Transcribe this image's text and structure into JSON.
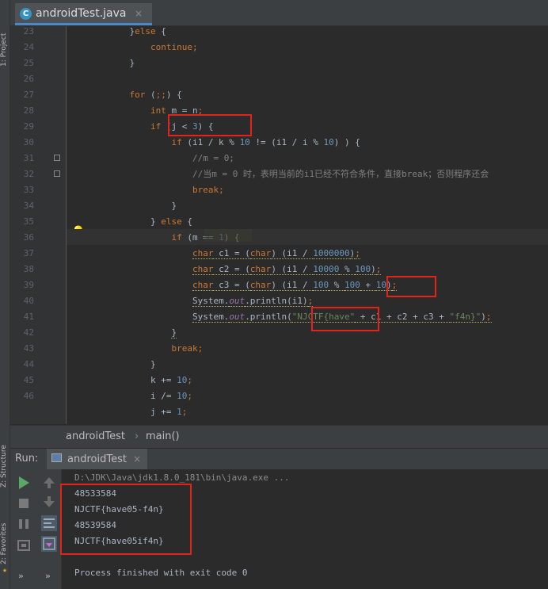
{
  "sidebar": {
    "project_label": "1: Project",
    "structure_label": "Z: Structure",
    "favorites_label": "2: Favorites"
  },
  "editor_tab": {
    "title": "androidTest.java",
    "close": "×"
  },
  "editor": {
    "line_numbers": [
      "23",
      "24",
      "25",
      "26",
      "27",
      "28",
      "29",
      "30",
      "31",
      "32",
      "33",
      "34",
      "35",
      "36",
      "37",
      "38",
      "39",
      "40",
      "41",
      "42",
      "43",
      "44",
      "45",
      "46"
    ],
    "lines": [
      {
        "indent": "            ",
        "parts": [
          {
            "t": "}",
            "c": ""
          },
          {
            "t": "else",
            "c": "kw"
          },
          {
            "t": " {",
            "c": ""
          }
        ]
      },
      {
        "indent": "                ",
        "parts": [
          {
            "t": "continue",
            "c": "kw"
          },
          {
            "t": ";",
            "c": "kw"
          }
        ]
      },
      {
        "indent": "            ",
        "parts": [
          {
            "t": "}",
            "c": ""
          }
        ]
      },
      {
        "indent": "",
        "parts": []
      },
      {
        "indent": "            ",
        "parts": [
          {
            "t": "for",
            "c": "kw"
          },
          {
            "t": " (",
            "c": ""
          },
          {
            "t": ";;",
            "c": "kw"
          },
          {
            "t": ") {",
            "c": ""
          }
        ]
      },
      {
        "indent": "                ",
        "parts": [
          {
            "t": "int",
            "c": "kw"
          },
          {
            "t": " m = n",
            "c": ""
          },
          {
            "t": ";",
            "c": "kw"
          }
        ]
      },
      {
        "indent": "                ",
        "parts": [
          {
            "t": "if",
            "c": "kw"
          },
          {
            "t": " (j < ",
            "c": ""
          },
          {
            "t": "3",
            "c": "num"
          },
          {
            "t": ") {",
            "c": ""
          }
        ]
      },
      {
        "indent": "                    ",
        "parts": [
          {
            "t": "if",
            "c": "kw"
          },
          {
            "t": " (i1 / k % ",
            "c": ""
          },
          {
            "t": "10",
            "c": "num"
          },
          {
            "t": " != (i1 / i % ",
            "c": ""
          },
          {
            "t": "10",
            "c": "num"
          },
          {
            "t": ") ) {",
            "c": ""
          }
        ]
      },
      {
        "indent": "                        ",
        "parts": [
          {
            "t": "//m = 0;",
            "c": "cm"
          }
        ]
      },
      {
        "indent": "                        ",
        "parts": [
          {
            "t": "//当m = 0 时，表明当前的i1已经不符合条件，直接break；否则程序还会",
            "c": "cm"
          }
        ]
      },
      {
        "indent": "                        ",
        "parts": [
          {
            "t": "break",
            "c": "kw"
          },
          {
            "t": ";",
            "c": "kw"
          }
        ]
      },
      {
        "indent": "                    ",
        "parts": [
          {
            "t": "}",
            "c": ""
          }
        ]
      },
      {
        "indent": "                ",
        "parts": [
          {
            "t": "} ",
            "c": ""
          },
          {
            "t": "else",
            "c": "kw"
          },
          {
            "t": " {",
            "c": ""
          }
        ]
      },
      {
        "indent": "                    ",
        "parts": [
          {
            "t": "if",
            "c": "kw"
          },
          {
            "t": " (m == ",
            "c": ""
          },
          {
            "t": "1",
            "c": "num"
          },
          {
            "t": ") {",
            "c": ""
          }
        ]
      },
      {
        "indent": "                        ",
        "parts": [
          {
            "t": "char",
            "c": "kw"
          },
          {
            "t": " c1 = (",
            "c": ""
          },
          {
            "t": "char",
            "c": "kw"
          },
          {
            "t": ") (i1 / ",
            "c": ""
          },
          {
            "t": "1000000",
            "c": "num"
          },
          {
            "t": ")",
            "c": ""
          },
          {
            "t": ";",
            "c": "kw"
          }
        ]
      },
      {
        "indent": "                        ",
        "parts": [
          {
            "t": "char",
            "c": "kw"
          },
          {
            "t": " c2 = (",
            "c": ""
          },
          {
            "t": "char",
            "c": "kw"
          },
          {
            "t": ") (i1 / ",
            "c": ""
          },
          {
            "t": "10000",
            "c": "num"
          },
          {
            "t": " % ",
            "c": ""
          },
          {
            "t": "100",
            "c": "num"
          },
          {
            "t": ")",
            "c": ""
          },
          {
            "t": ";",
            "c": "kw"
          }
        ]
      },
      {
        "indent": "                        ",
        "parts": [
          {
            "t": "char",
            "c": "kw"
          },
          {
            "t": " c3 = (",
            "c": ""
          },
          {
            "t": "char",
            "c": "kw"
          },
          {
            "t": ") (i1 / ",
            "c": ""
          },
          {
            "t": "100",
            "c": "num"
          },
          {
            "t": " % ",
            "c": ""
          },
          {
            "t": "100",
            "c": "num"
          },
          {
            "t": " + ",
            "c": ""
          },
          {
            "t": "10",
            "c": "num"
          },
          {
            "t": ")",
            "c": ""
          },
          {
            "t": ";",
            "c": "kw"
          }
        ]
      },
      {
        "indent": "                        ",
        "parts": [
          {
            "t": "System.",
            "c": ""
          },
          {
            "t": "out",
            "c": "fld"
          },
          {
            "t": ".println(i1)",
            "c": ""
          },
          {
            "t": ";",
            "c": "kw"
          }
        ]
      },
      {
        "indent": "                        ",
        "parts": [
          {
            "t": "System.",
            "c": ""
          },
          {
            "t": "out",
            "c": "fld"
          },
          {
            "t": ".println(",
            "c": ""
          },
          {
            "t": "\"NJCTF{have\"",
            "c": "str"
          },
          {
            "t": " + c1 + c2 + c3 + ",
            "c": ""
          },
          {
            "t": "\"f4n}\"",
            "c": "str"
          },
          {
            "t": ")",
            "c": ""
          },
          {
            "t": ";",
            "c": "kw"
          }
        ]
      },
      {
        "indent": "                    ",
        "parts": [
          {
            "t": "}",
            "c": ""
          }
        ]
      },
      {
        "indent": "                    ",
        "parts": [
          {
            "t": "break",
            "c": "kw"
          },
          {
            "t": ";",
            "c": "kw"
          }
        ]
      },
      {
        "indent": "                ",
        "parts": [
          {
            "t": "}",
            "c": ""
          }
        ]
      },
      {
        "indent": "                ",
        "parts": [
          {
            "t": "k += ",
            "c": ""
          },
          {
            "t": "10",
            "c": "num"
          },
          {
            "t": ";",
            "c": "kw"
          }
        ]
      },
      {
        "indent": "                ",
        "parts": [
          {
            "t": "i /= ",
            "c": ""
          },
          {
            "t": "10",
            "c": "num"
          },
          {
            "t": ";",
            "c": "kw"
          }
        ]
      },
      {
        "indent": "                ",
        "parts": [
          {
            "t": "j += ",
            "c": ""
          },
          {
            "t": "1",
            "c": "num"
          },
          {
            "t": ";",
            "c": "kw"
          }
        ]
      }
    ]
  },
  "breadcrumb": {
    "class_name": "androidTest",
    "separator": "›",
    "method_name": "main()"
  },
  "run_panel": {
    "label": "Run:",
    "tab_title": "androidTest",
    "tab_close": "×",
    "console_lines": [
      "D:\\JDK\\Java\\jdk1.8.0_181\\bin\\java.exe ...",
      "48533584",
      "NJCTF{have05-f4n}",
      "48539584",
      "NJCTF{have05if4n}",
      "",
      "Process finished with exit code 0"
    ]
  },
  "colors": {
    "highlight_box": "#e2231a",
    "run_green": "#59a869",
    "tab_accent": "#4a88c7"
  }
}
